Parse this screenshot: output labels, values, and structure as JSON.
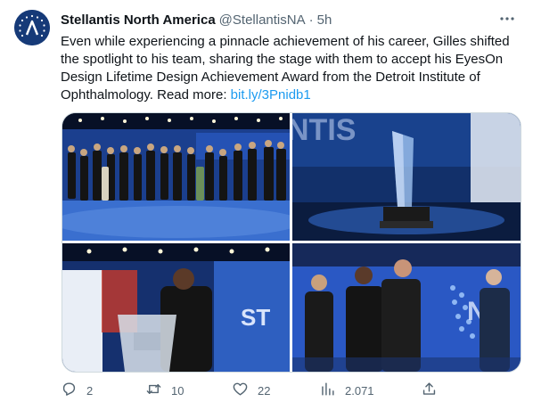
{
  "tweet": {
    "author_name": "Stellantis North America",
    "author_handle": "@StellantisNA",
    "separator": "·",
    "time": "5h",
    "text": "Even while experiencing a pinnacle achievement of his career, Gilles shifted the spotlight to his team, sharing the stage with them to accept his EyesOn Design Lifetime Design Achievement Award from the Detroit Institute of Ophthalmology. Read more: ",
    "link": "bit.ly/3Pnidb1",
    "photo_brand_text_top": "NTIS",
    "photo_brand_text_bottom": "ST",
    "photo_brand_text_p4": "N"
  },
  "actions": {
    "reply_count": "2",
    "retweet_count": "10",
    "like_count": "22",
    "views_count": "2.071"
  },
  "icons": {
    "avatar": "stellantis-logo-icon",
    "more": "more-horizontal-icon",
    "reply": "reply-icon",
    "retweet": "retweet-icon",
    "like": "heart-icon",
    "views": "views-icon",
    "share": "share-icon"
  },
  "colors": {
    "accent": "#1d9bf0",
    "muted": "#536471",
    "avatar_bg": "#163a78"
  }
}
